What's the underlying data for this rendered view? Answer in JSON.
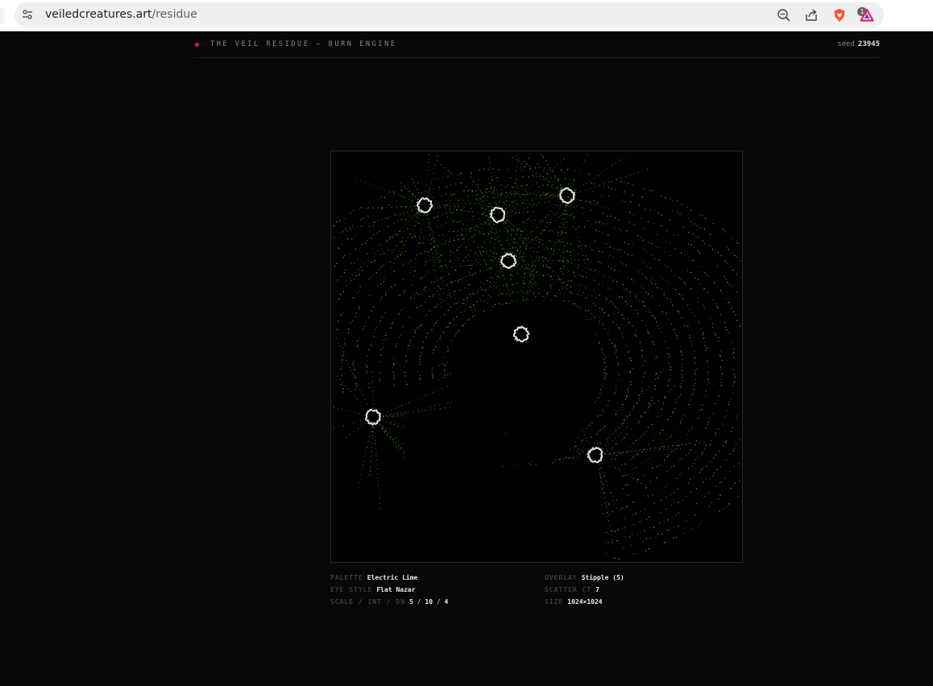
{
  "browser": {
    "url_domain": "veiledcreatures.art",
    "url_path": "/residue",
    "badge_count": "1",
    "icons": [
      "tune-icon",
      "zoom-out-icon",
      "share-icon",
      "brave-shield-icon",
      "brave-rewards-icon"
    ]
  },
  "header": {
    "title": "THE VEIL RESIDUE — BURN ENGINE",
    "seed_label": "seed",
    "seed_value": "23945"
  },
  "artwork": {
    "palette_color": "#66dd33",
    "eye_count": 7,
    "eye_color": "#e6e6e6"
  },
  "meta": {
    "palette_label": "PALETTE",
    "palette_value": "Electric Lime",
    "eye_style_label": "EYE STYLE",
    "eye_style_value": "Flat Nazar",
    "scale_label": "SCALE / INT / DN",
    "scale_value": "5",
    "int_value": "10",
    "dn_value": "4",
    "slash": "/",
    "overlay_label": "OVERLAY",
    "overlay_value": "Stipple (5)",
    "scatter_label": "SCATTER CT",
    "scatter_value": "7",
    "size_label": "SIZE",
    "size_value": "1024×1024"
  },
  "colors": {
    "accent_red": "#b91d1d",
    "background": "#080808"
  }
}
